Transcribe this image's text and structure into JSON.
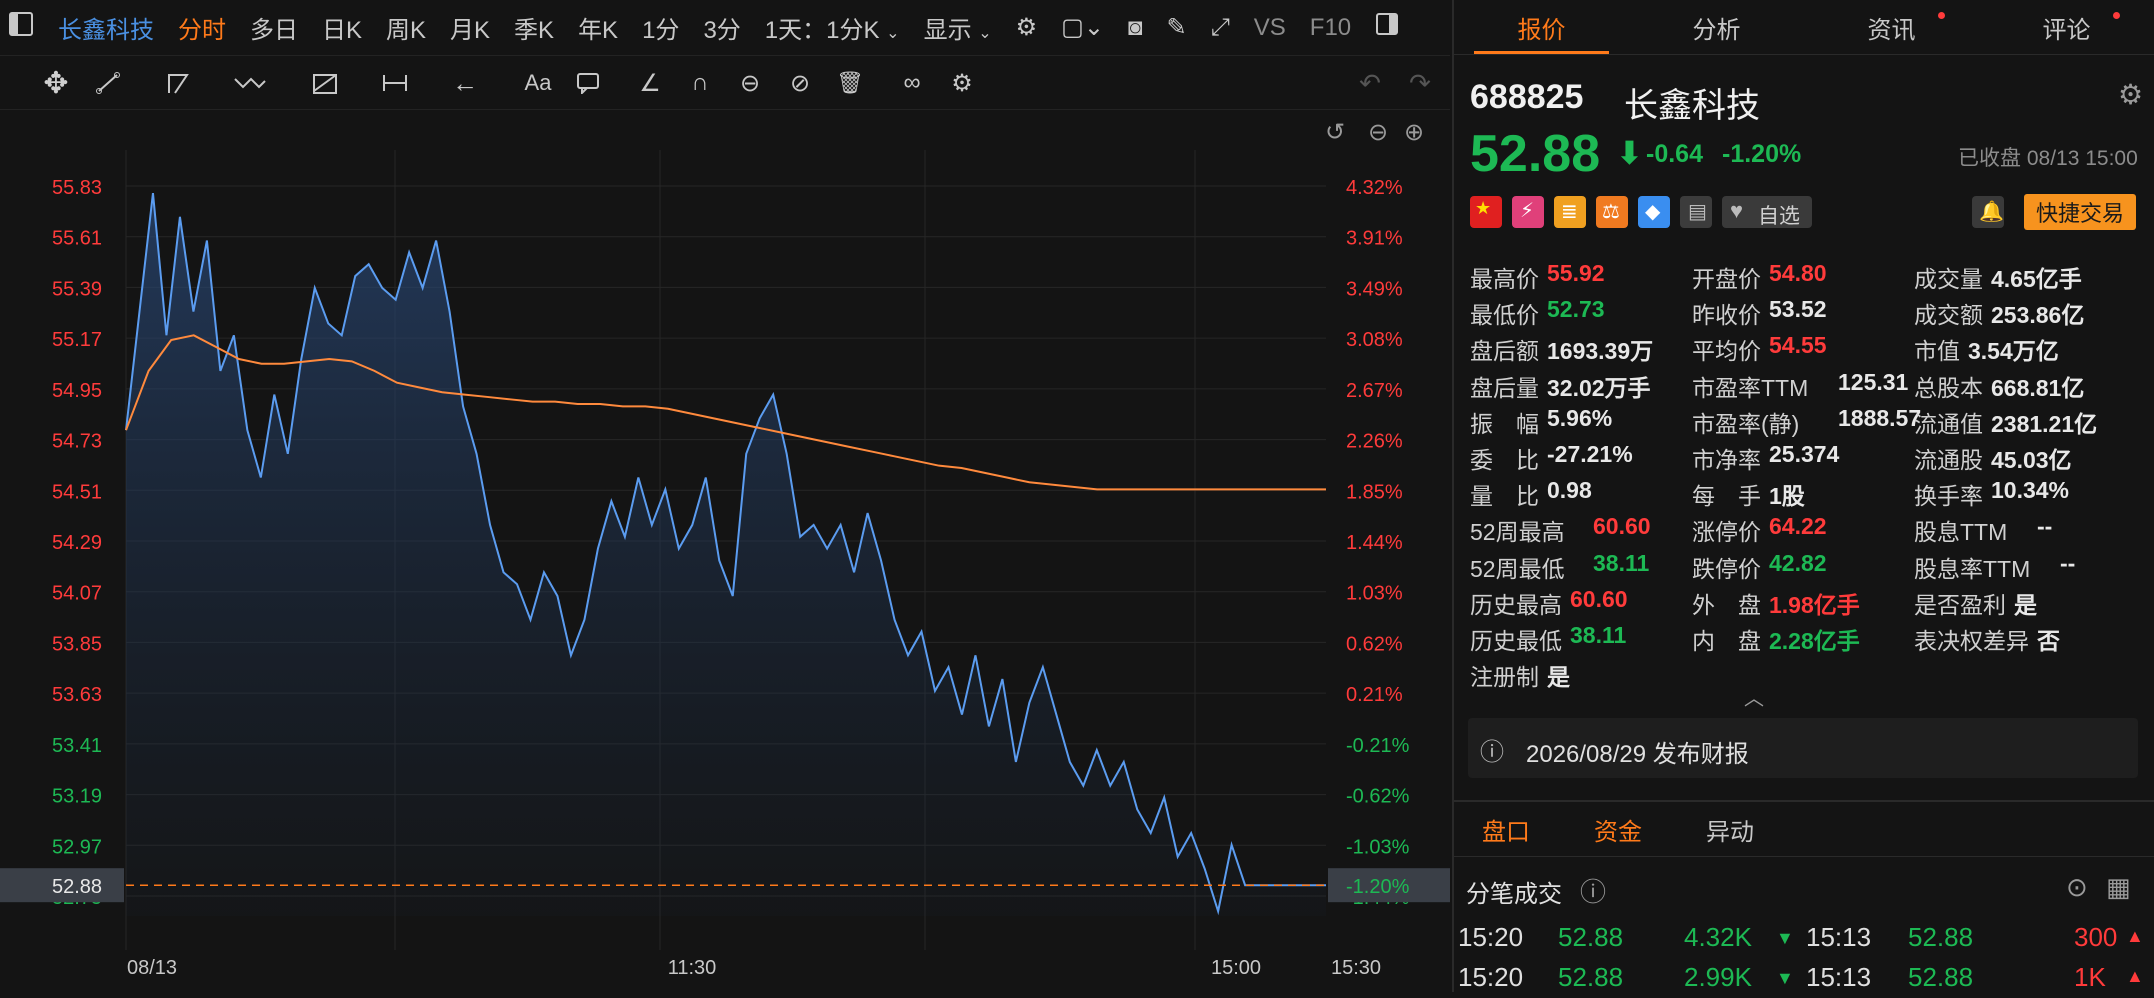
{
  "topbar": {
    "stock_name": "长鑫科技",
    "tabs": [
      "分时",
      "多日",
      "日K",
      "周K",
      "月K",
      "季K",
      "年K",
      "1分",
      "3分"
    ],
    "active_tab": "分时",
    "period_select": "1天：1分K",
    "display_label": "显示",
    "vs_label": "VS",
    "f10_label": "F10"
  },
  "right_tabs": [
    "报价",
    "分析",
    "资讯",
    "评论"
  ],
  "quote": {
    "code": "688825",
    "name": "长鑫科技",
    "price": "52.88",
    "change": "-0.64",
    "change_pct": "-1.20%",
    "status": "已收盘 08/13 15:00",
    "watch_label": "自选",
    "trade_button": "快捷交易"
  },
  "stats": [
    [
      {
        "l": "最高价",
        "v": "55.92",
        "c": "r"
      },
      {
        "l": "开盘价",
        "v": "54.80",
        "c": "r"
      },
      {
        "l": "成交量",
        "v": "4.65亿手",
        "c": "w"
      }
    ],
    [
      {
        "l": "最低价",
        "v": "52.73",
        "c": "g"
      },
      {
        "l": "昨收价",
        "v": "53.52",
        "c": "w"
      },
      {
        "l": "成交额",
        "v": "253.86亿",
        "c": "w"
      }
    ],
    [
      {
        "l": "盘后额",
        "v": "1693.39万",
        "c": "w"
      },
      {
        "l": "平均价",
        "v": "54.55",
        "c": "r"
      },
      {
        "l": "市值",
        "v": "3.54万亿",
        "c": "w"
      }
    ],
    [
      {
        "l": "盘后量",
        "v": "32.02万手",
        "c": "w"
      },
      {
        "l": "市盈率TTM",
        "v": "125.31",
        "c": "w"
      },
      {
        "l": "总股本",
        "v": "668.81亿",
        "c": "w"
      }
    ],
    [
      {
        "l": "振　幅",
        "v": "5.96%",
        "c": "w"
      },
      {
        "l": "市盈率(静)",
        "v": "1888.57",
        "c": "w"
      },
      {
        "l": "流通值",
        "v": "2381.21亿",
        "c": "w"
      }
    ],
    [
      {
        "l": "委　比",
        "v": "-27.21%",
        "c": "w"
      },
      {
        "l": "市净率",
        "v": "25.374",
        "c": "w"
      },
      {
        "l": "流通股",
        "v": "45.03亿",
        "c": "w"
      }
    ],
    [
      {
        "l": "量　比",
        "v": "0.98",
        "c": "w"
      },
      {
        "l": "每　手",
        "v": "1股",
        "c": "w"
      },
      {
        "l": "换手率",
        "v": "10.34%",
        "c": "w"
      }
    ],
    [
      {
        "l": "52周最高",
        "v": "60.60",
        "c": "r"
      },
      {
        "l": "涨停价",
        "v": "64.22",
        "c": "r"
      },
      {
        "l": "股息TTM",
        "v": "--",
        "c": "w"
      }
    ],
    [
      {
        "l": "52周最低",
        "v": "38.11",
        "c": "g"
      },
      {
        "l": "跌停价",
        "v": "42.82",
        "c": "g"
      },
      {
        "l": "股息率TTM",
        "v": "--",
        "c": "w"
      }
    ],
    [
      {
        "l": "历史最高",
        "v": "60.60",
        "c": "r"
      },
      {
        "l": "外　盘",
        "v": "1.98亿手",
        "c": "r"
      },
      {
        "l": "是否盈利",
        "v": "是",
        "c": "w"
      }
    ],
    [
      {
        "l": "历史最低",
        "v": "38.11",
        "c": "g"
      },
      {
        "l": "内　盘",
        "v": "2.28亿手",
        "c": "g"
      },
      {
        "l": "表决权差异",
        "v": "否",
        "c": "w"
      }
    ],
    [
      {
        "l": "注册制",
        "v": "是",
        "c": "w"
      }
    ]
  ],
  "notice": "2026/08/29  发布财报",
  "sub_tabs": [
    "盘口",
    "资金",
    "异动"
  ],
  "ticks_title": "分笔成交",
  "ticks": [
    {
      "t1": "15:20",
      "p1": "52.88",
      "v1": "4.32K",
      "t2": "15:13",
      "p2": "52.88",
      "v2": "300"
    },
    {
      "t1": "15:20",
      "p1": "52.88",
      "v1": "2.99K",
      "t2": "15:13",
      "p2": "52.88",
      "v2": "1K"
    }
  ],
  "colors": {
    "up": "#ff3b3b",
    "down": "#1db954",
    "accent": "#ff7a1a",
    "price_line": "#5b9cf0",
    "avg_line": "#ff8a3d"
  },
  "chart_data": {
    "type": "line",
    "x_labels": [
      "08/13",
      "11:30",
      "15:00",
      "15:30"
    ],
    "y_left": [
      "55.83",
      "55.61",
      "55.39",
      "55.17",
      "54.95",
      "54.73",
      "54.51",
      "54.29",
      "54.07",
      "53.85",
      "53.63",
      "53.41",
      "53.19",
      "52.97",
      "52.75"
    ],
    "y_right": [
      "4.32%",
      "3.91%",
      "3.49%",
      "3.08%",
      "2.67%",
      "2.26%",
      "1.85%",
      "1.44%",
      "1.03%",
      "0.62%",
      "0.21%",
      "-0.21%",
      "-0.62%",
      "-1.03%",
      "-1.44%"
    ],
    "current_price": "52.88",
    "current_pct": "-1.20%",
    "prev_close": 53.52,
    "ylim": [
      52.75,
      55.83
    ],
    "series": [
      {
        "role": "price",
        "values": [
          54.8,
          55.3,
          55.8,
          55.2,
          55.7,
          55.3,
          55.6,
          55.05,
          55.2,
          54.8,
          54.6,
          54.95,
          54.7,
          55.1,
          55.4,
          55.25,
          55.2,
          55.45,
          55.5,
          55.4,
          55.35,
          55.55,
          55.4,
          55.6,
          55.3,
          54.9,
          54.7,
          54.4,
          54.2,
          54.15,
          54.0,
          54.2,
          54.1,
          53.85,
          54.0,
          54.3,
          54.5,
          54.35,
          54.6,
          54.4,
          54.55,
          54.3,
          54.4,
          54.6,
          54.25,
          54.1,
          54.7,
          54.85,
          54.95,
          54.7,
          54.35,
          54.4,
          54.3,
          54.4,
          54.2,
          54.45,
          54.25,
          54.0,
          53.85,
          53.95,
          53.7,
          53.8,
          53.6,
          53.85,
          53.55,
          53.75,
          53.4,
          53.65,
          53.8,
          53.6,
          53.4,
          53.3,
          53.45,
          53.3,
          53.4,
          53.2,
          53.1,
          53.25,
          53.0,
          53.1,
          52.95,
          52.77,
          53.05,
          52.88,
          52.88,
          52.88,
          52.88,
          52.88,
          52.88,
          52.88
        ]
      },
      {
        "role": "average",
        "values": [
          54.8,
          55.05,
          55.18,
          55.2,
          55.15,
          55.1,
          55.08,
          55.08,
          55.09,
          55.1,
          55.09,
          55.05,
          55.0,
          54.98,
          54.96,
          54.95,
          54.94,
          54.93,
          54.92,
          54.92,
          54.91,
          54.91,
          54.9,
          54.9,
          54.89,
          54.87,
          54.85,
          54.83,
          54.81,
          54.79,
          54.77,
          54.75,
          54.73,
          54.71,
          54.69,
          54.67,
          54.65,
          54.64,
          54.62,
          54.6,
          54.58,
          54.57,
          54.56,
          54.55,
          54.55,
          54.55,
          54.55,
          54.55,
          54.55
        ]
      }
    ]
  }
}
